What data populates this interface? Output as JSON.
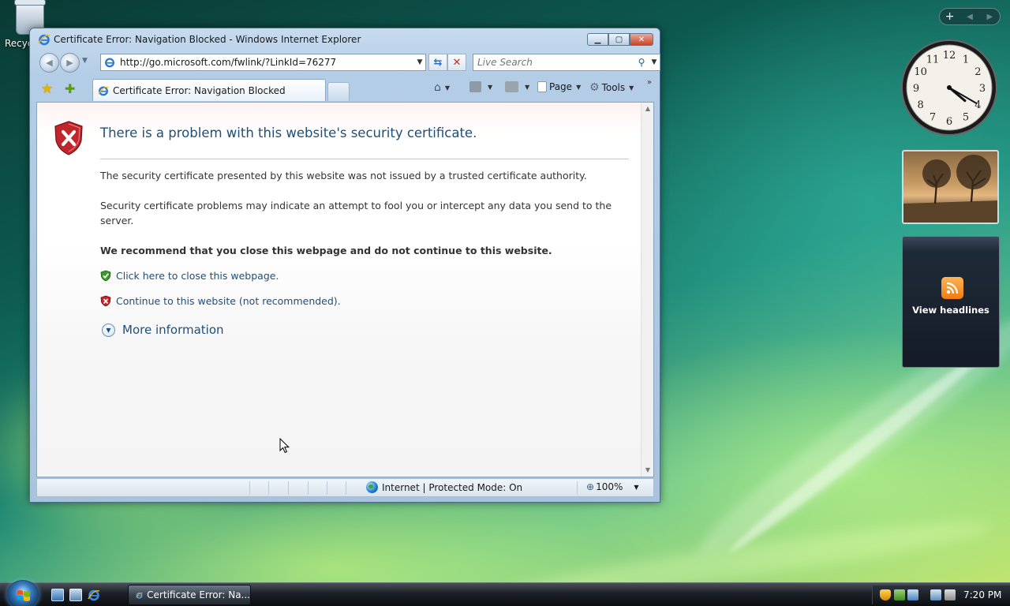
{
  "desktop": {
    "recycle_bin_label": "Recyc"
  },
  "window": {
    "title": "Certificate Error: Navigation Blocked - Windows Internet Explorer",
    "address_url": "http://go.microsoft.com/fwlink/?LinkId=76277",
    "search_placeholder": "Live Search",
    "tab_label": "Certificate Error: Navigation Blocked",
    "commands": {
      "page_label": "Page",
      "tools_label": "Tools"
    }
  },
  "content": {
    "heading": "There is a problem with this website's security certificate.",
    "paragraph_1": "The security certificate presented by this website was not issued by a trusted certificate authority.",
    "paragraph_2": "Security certificate problems may indicate an attempt to fool you or intercept any data you send to the server.",
    "recommendation": "We recommend that you close this webpage and do not continue to this website.",
    "close_link": "Click here to close this webpage.",
    "continue_link": "Continue to this website (not recommended).",
    "more_info": "More information"
  },
  "statusbar": {
    "zone": "Internet | Protected Mode: On",
    "zoom": "100%"
  },
  "sidebar": {
    "feed_label": "View headlines"
  },
  "taskbar": {
    "active_window_label": "Certificate Error: Na...",
    "clock_time": "7:20 PM"
  },
  "clock_gadget": {
    "hour": 4,
    "minute": 20
  },
  "colors": {
    "link_blue": "#1f4e79",
    "error_red": "#c0262c",
    "safe_green": "#3a9a2a"
  }
}
